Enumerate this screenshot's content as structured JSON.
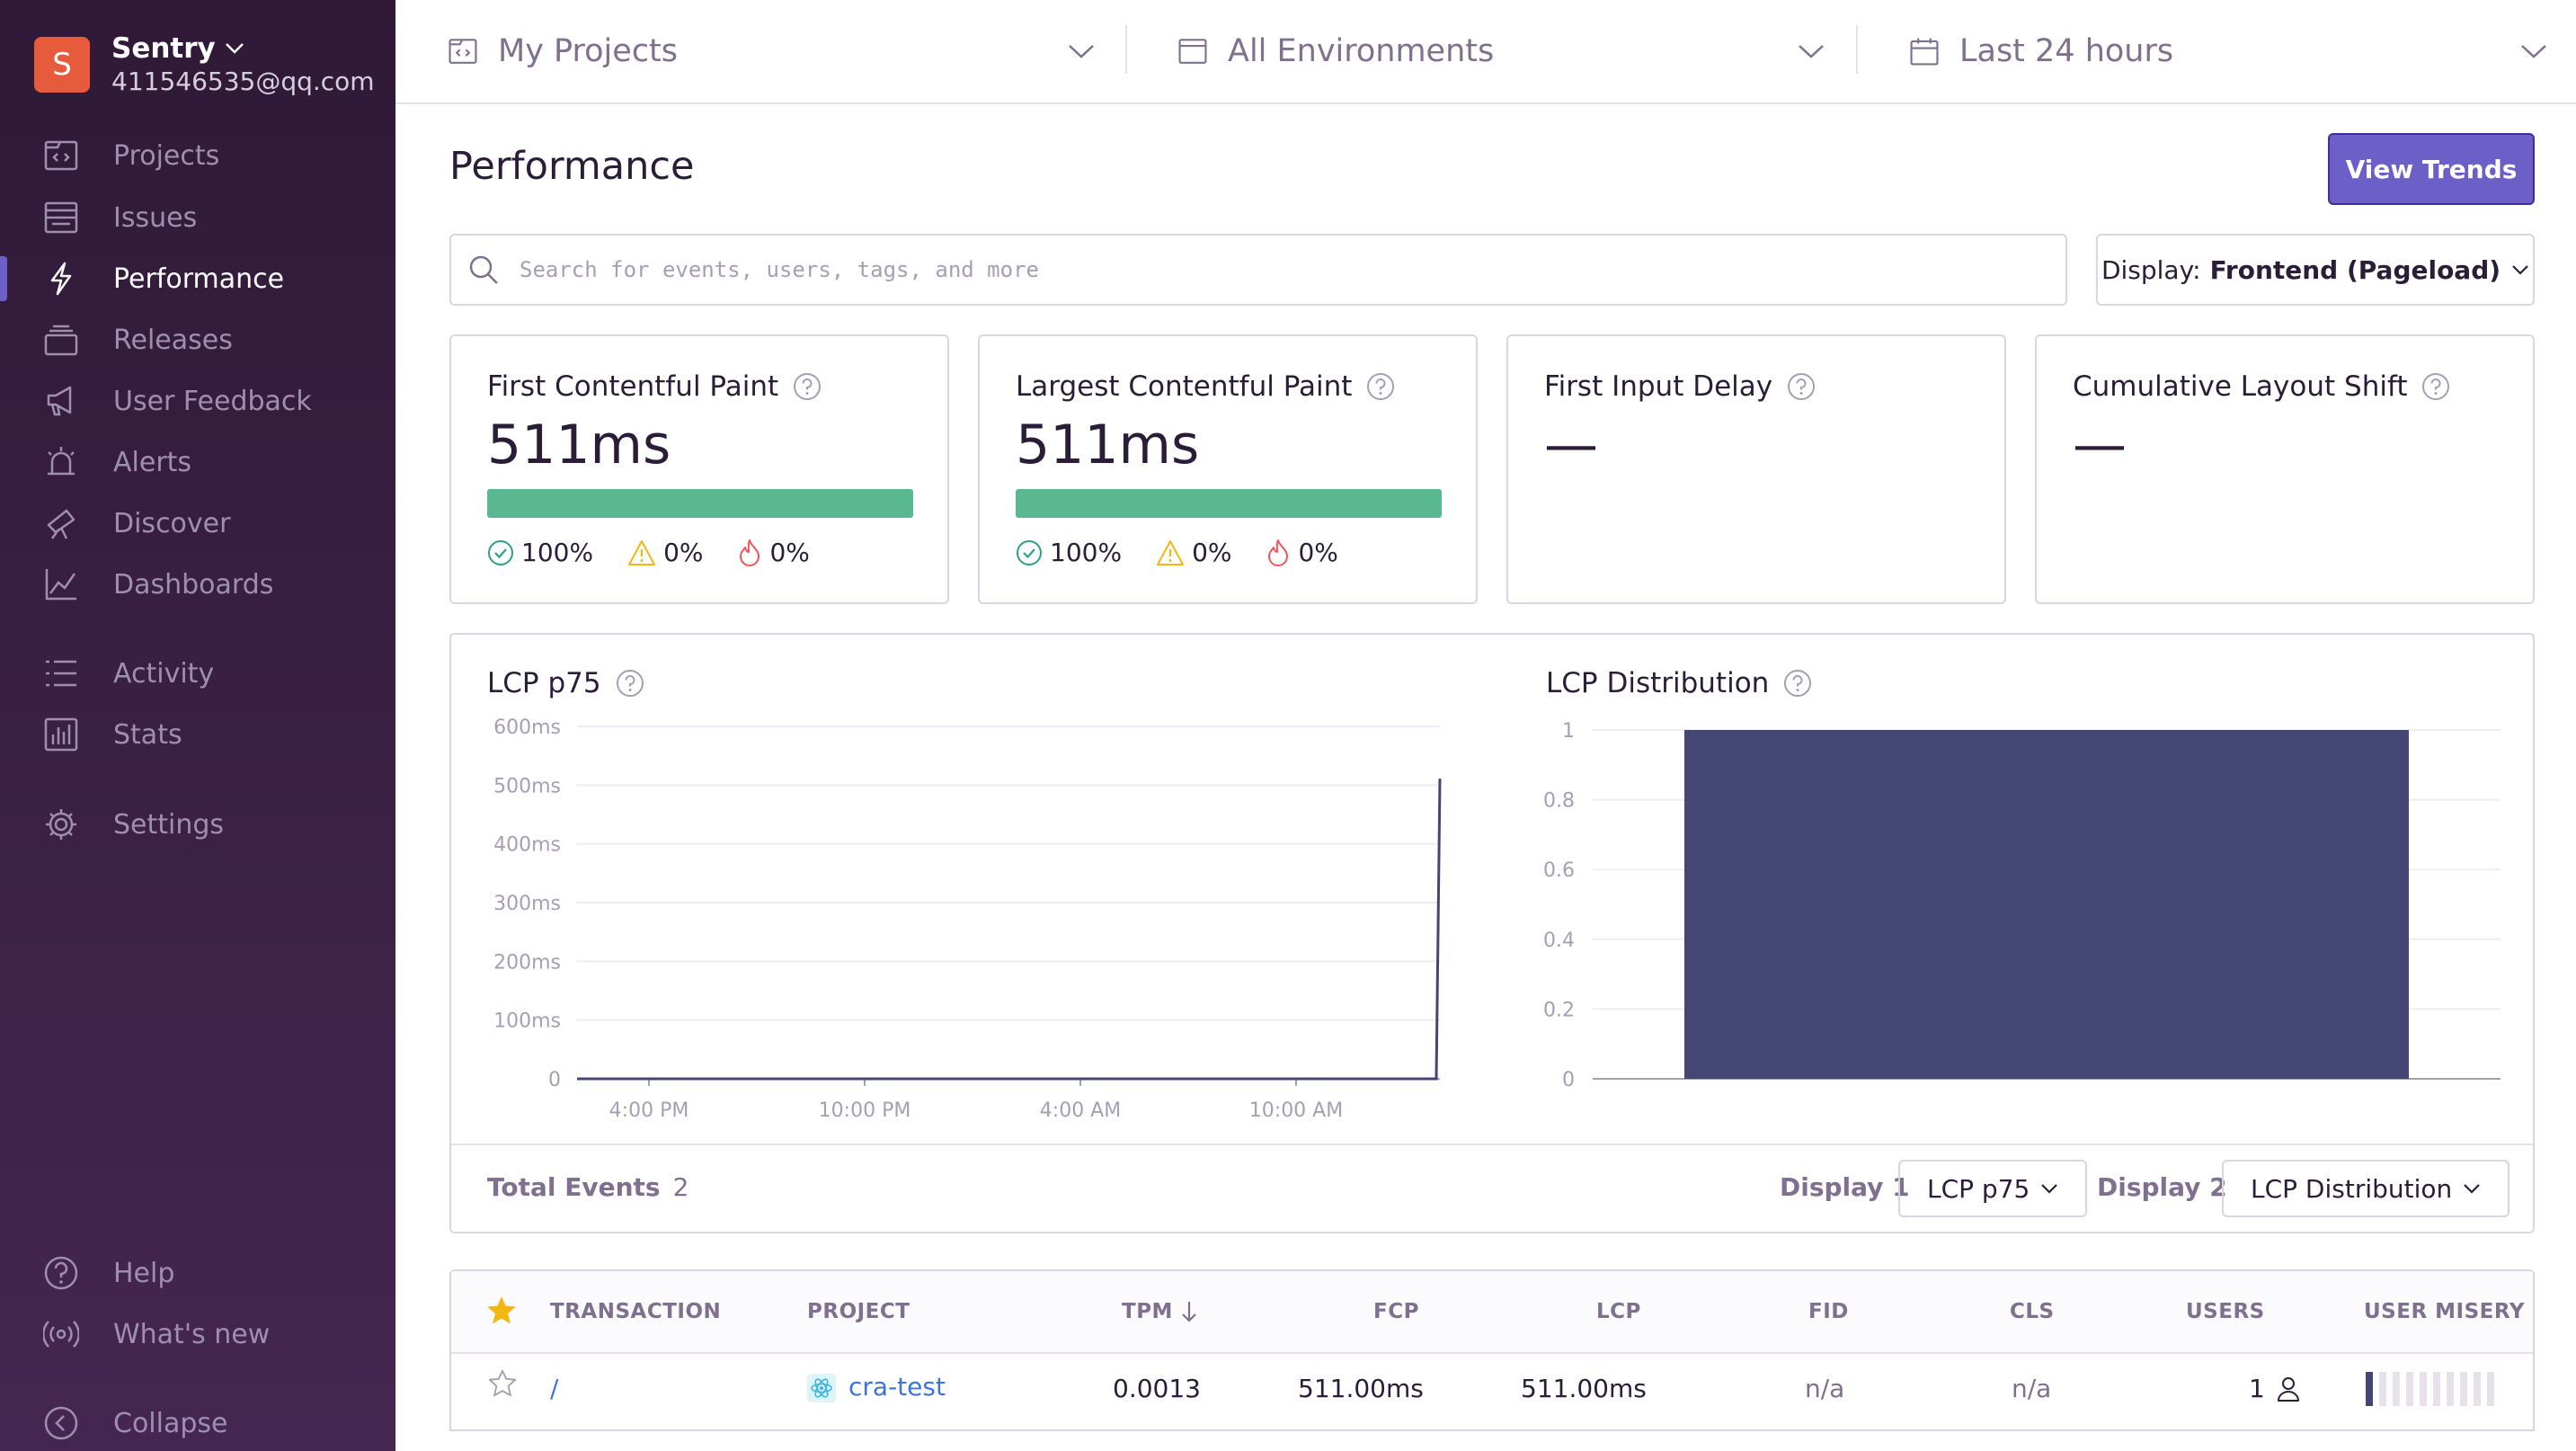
{
  "org": {
    "initial": "S",
    "name": "Sentry",
    "email": "411546535@qq.com"
  },
  "nav": {
    "projects": "Projects",
    "issues": "Issues",
    "performance": "Performance",
    "releases": "Releases",
    "user_feedback": "User Feedback",
    "alerts": "Alerts",
    "discover": "Discover",
    "dashboards": "Dashboards",
    "activity": "Activity",
    "stats": "Stats",
    "settings": "Settings",
    "help": "Help",
    "whats_new": "What's new",
    "collapse": "Collapse"
  },
  "topbar": {
    "projects": "My Projects",
    "environments": "All Environments",
    "period": "Last 24 hours"
  },
  "page": {
    "title": "Performance",
    "view_trends": "View Trends"
  },
  "search": {
    "placeholder": "Search for events, users, tags, and more"
  },
  "display": {
    "label": "Display:",
    "value": "Frontend (Pageload)"
  },
  "cards": [
    {
      "title": "First Contentful Paint",
      "value": "511ms",
      "good": "100%",
      "meh": "0%",
      "poor": "0%"
    },
    {
      "title": "Largest Contentful Paint",
      "value": "511ms",
      "good": "100%",
      "meh": "0%",
      "poor": "0%"
    },
    {
      "title": "First Input Delay",
      "value": "—"
    },
    {
      "title": "Cumulative Layout Shift",
      "value": "—"
    }
  ],
  "colors": {
    "accent": "#6c5fc7",
    "good": "#59b88f",
    "warning": "#f2b712",
    "error": "#f55459",
    "bar": "#444674",
    "link": "#3d74db"
  },
  "chart_data": [
    {
      "type": "line",
      "title": "LCP p75",
      "ylabel": "",
      "y_ticks": [
        "600ms",
        "500ms",
        "400ms",
        "300ms",
        "200ms",
        "100ms",
        "0"
      ],
      "ylim": [
        0,
        600
      ],
      "x_ticks": [
        "4:00 PM",
        "10:00 PM",
        "4:00 AM",
        "10:00 AM"
      ],
      "x_tick_hours": [
        0,
        6,
        12,
        18
      ],
      "xlim_hours": [
        -2,
        22
      ],
      "series": [
        {
          "x_hours": [
            -2,
            21.9,
            22
          ],
          "values": [
            0,
            0,
            511
          ]
        }
      ],
      "grid": true
    },
    {
      "type": "bar",
      "title": "LCP Distribution",
      "y_ticks": [
        "1",
        "0.8",
        "0.6",
        "0.4",
        "0.2",
        "0"
      ],
      "ylim": [
        0,
        1
      ],
      "values": [
        1
      ],
      "grid": true
    }
  ],
  "chart_footer": {
    "total_events_label": "Total Events",
    "total_events": "2",
    "display1_label": "Display 1",
    "display1_value": "LCP p75",
    "display2_label": "Display 2",
    "display2_value": "LCP Distribution"
  },
  "table": {
    "headers": [
      "TRANSACTION",
      "PROJECT",
      "TPM",
      "FCP",
      "LCP",
      "FID",
      "CLS",
      "USERS",
      "USER MISERY"
    ],
    "rows": [
      {
        "transaction": "/",
        "project": "cra-test",
        "tpm": "0.0013",
        "fcp": "511.00ms",
        "lcp": "511.00ms",
        "fid": "n/a",
        "cls": "n/a",
        "users": "1",
        "user_misery_bars": 1,
        "user_misery_total": 10
      }
    ]
  }
}
